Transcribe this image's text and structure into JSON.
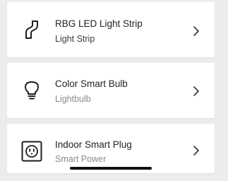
{
  "devices": [
    {
      "name": "RBG LED Light Strip",
      "type": "Light Strip",
      "icon": "light-strip-icon"
    },
    {
      "name": "Color Smart Bulb",
      "type": "Lightbulb",
      "icon": "lightbulb-icon"
    },
    {
      "name": "Indoor Smart Plug",
      "type": "Smart Power",
      "icon": "smart-plug-icon"
    }
  ],
  "chevron_icon": "chevron-right-icon",
  "colors": {
    "background": "#ececef",
    "card": "#ffffff",
    "title_text": "#222222",
    "subtitle_text": "#8a8a8e",
    "home_indicator": "#111111"
  }
}
